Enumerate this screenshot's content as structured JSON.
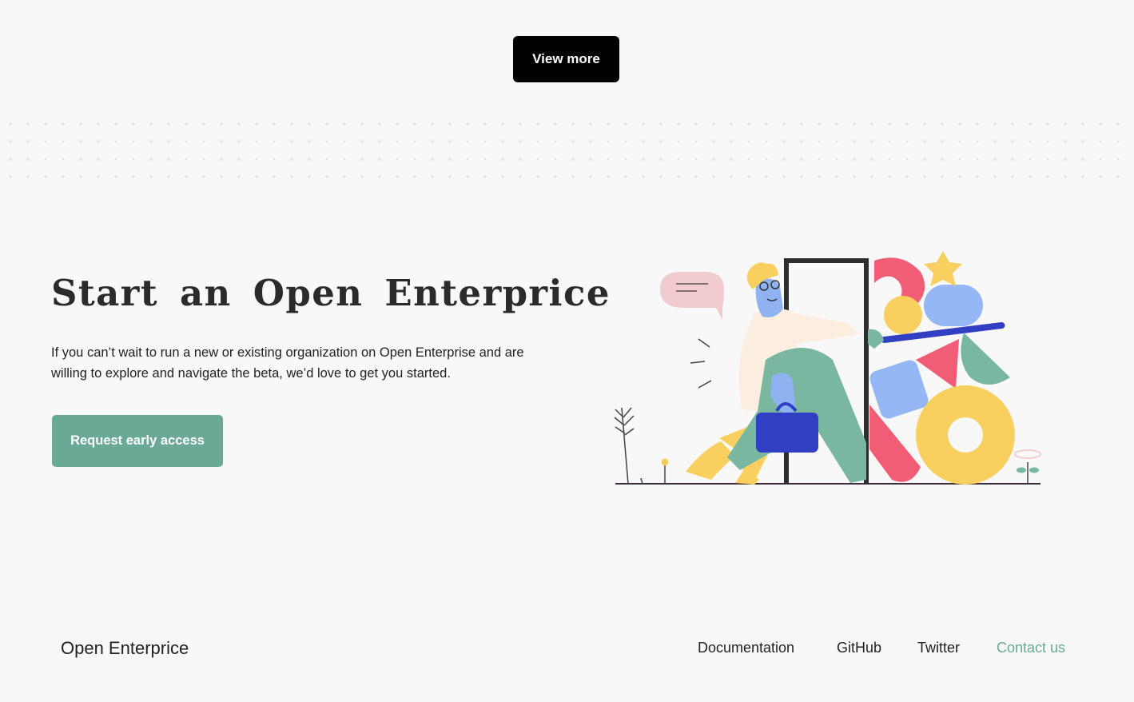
{
  "top": {
    "view_more_label": "View more"
  },
  "hero": {
    "title": "Start an Open Enterprice",
    "body": "If you can’t wait to run a new or existing organization on Open Enterprise and are willing to explore and navigate the beta, we’d love to get you started.",
    "cta_label": "Request early access"
  },
  "footer": {
    "brand": "Open Enterprice",
    "links": [
      {
        "label": "Documentation"
      },
      {
        "label": "GitHub"
      },
      {
        "label": "Twitter"
      },
      {
        "label": "Contact us"
      }
    ]
  },
  "colors": {
    "accent_green": "#6aa995",
    "button_black": "#000000",
    "background": "#f8f8f8"
  }
}
